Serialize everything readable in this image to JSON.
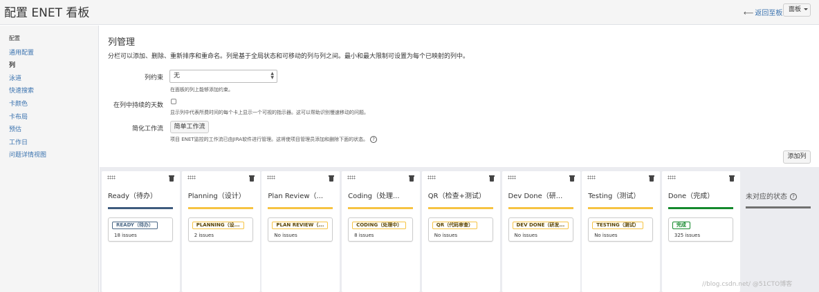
{
  "header": {
    "title": "配置 ENET 看板",
    "back_arrow": "⟵",
    "back_label": "返回至板",
    "board_button": "面板"
  },
  "sidebar": {
    "heading": "配置",
    "items": [
      {
        "label": "通用配置"
      },
      {
        "label": "列"
      },
      {
        "label": "泳道"
      },
      {
        "label": "快速搜索"
      },
      {
        "label": "卡颜色"
      },
      {
        "label": "卡布局"
      },
      {
        "label": "预估"
      },
      {
        "label": "工作日"
      },
      {
        "label": "问题详情视图"
      }
    ]
  },
  "main": {
    "title": "列管理",
    "description": "分栏可以添加、删除、重新排序和重命名。列是基于全局状态和可移动的列与列之间。最小和最大限制可设置为每个已映射的列中。",
    "constraint": {
      "label": "列约束",
      "value": "无",
      "help": "在面板的列上能够添加约束。"
    },
    "days_in_column": {
      "label": "在列中持续的天数",
      "checked": false,
      "help": "显示列中代表所费时间的每个卡上显示一个可视的指示器。这可以帮助识别慢速移动的问题。"
    },
    "simplified_workflow": {
      "label": "简化工作流",
      "button": "简单工作流",
      "help": "项目 ENET监控的工作流已由JIRA软件进行管理。这将使项目管理员添加和删除下面的状态。",
      "help_icon": "?"
    },
    "add_column_button": "添加列"
  },
  "columns": [
    {
      "name": "Ready（待办）",
      "bar_color": "#3e5b7d",
      "status": "READY（待办）",
      "status_style": "blue-gray",
      "count": "18 issues"
    },
    {
      "name": "Planning（设计）",
      "bar_color": "#f6c342",
      "status": "PLANNING（设...",
      "status_style": "yellow",
      "count": "2 issues"
    },
    {
      "name": "Plan Review（...",
      "bar_color": "#f6c342",
      "status": "PLAN REVIEW（...",
      "status_style": "yellow",
      "count": "No issues"
    },
    {
      "name": "Coding（处理...",
      "bar_color": "#f6c342",
      "status": "CODING（处理中）",
      "status_style": "yellow",
      "count": "8 issues"
    },
    {
      "name": "QR（检查+测试）",
      "bar_color": "#f6c342",
      "status": "QR（代码审查）",
      "status_style": "yellow",
      "count": "No issues"
    },
    {
      "name": "Dev Done（研...",
      "bar_color": "#f6c342",
      "status": "DEV DONE（研发...",
      "status_style": "yellow",
      "count": "No issues"
    },
    {
      "name": "Testing（测试）",
      "bar_color": "#f6c342",
      "status": "TESTING（测试）",
      "status_style": "yellow",
      "count": "No issues"
    },
    {
      "name": "Done（完成）",
      "bar_color": "#14892c",
      "status": "完成",
      "status_style": "green",
      "count": "325 issues"
    }
  ],
  "unmapped": {
    "label": "未对应的状态",
    "help_icon": "?"
  },
  "watermark": "//blog.csdn.net/ @51CTO博客",
  "colors": {
    "link": "#3b73af",
    "todo": "#3e5b7d",
    "in_progress": "#f6c342",
    "done": "#14892c",
    "unmapped": "#707070"
  }
}
